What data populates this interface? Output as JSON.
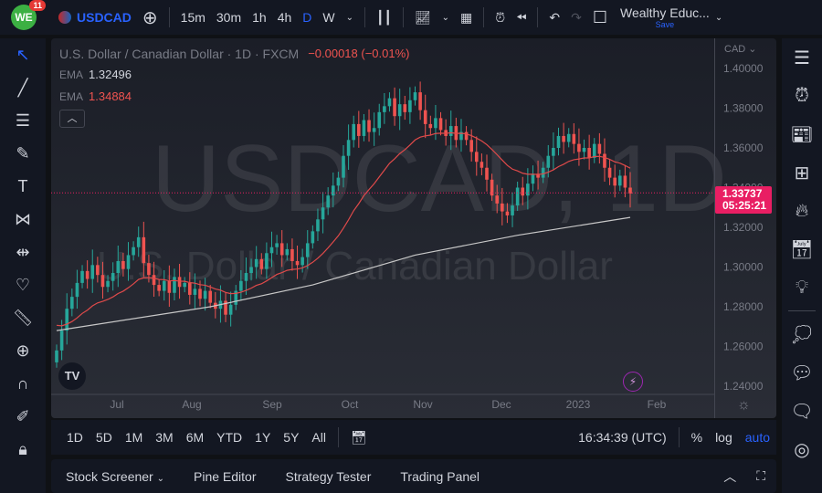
{
  "topbar": {
    "notif_count": "11",
    "symbol": "USDCAD",
    "intervals": [
      "15m",
      "30m",
      "1h",
      "4h",
      "D",
      "W"
    ],
    "layout_name": "Wealthy Educ...",
    "save_label": "Save"
  },
  "legend": {
    "title": "U.S. Dollar / Canadian Dollar · 1D · FXCM",
    "change": "−0.00018 (−0.01%)",
    "ema1_label": "EMA",
    "ema1_value": "1.32496",
    "ema2_label": "EMA",
    "ema2_value": "1.34884"
  },
  "watermark": {
    "symbol": "USDCAD, 1D",
    "name": "U.S. Dollar / Canadian Dollar"
  },
  "price_axis": {
    "currency": "CAD",
    "current_price": "1.33737",
    "countdown": "05:25:21"
  },
  "timeframes": [
    "1D",
    "5D",
    "1M",
    "3M",
    "6M",
    "YTD",
    "1Y",
    "5Y",
    "All"
  ],
  "clock": "16:34:39 (UTC)",
  "axis_options": {
    "percent": "%",
    "log": "log",
    "auto": "auto"
  },
  "bottom_tabs": [
    "Stock Screener",
    "Pine Editor",
    "Strategy Tester",
    "Trading Panel"
  ],
  "colors": {
    "up": "#26a69a",
    "down": "#ef5350",
    "ema_fast": "#e04a4a",
    "ema_slow": "#c8c8c8",
    "accent": "#2962ff",
    "price_label": "#e91e63"
  },
  "chart_data": {
    "type": "candlestick",
    "ylim": [
      1.235,
      1.405
    ],
    "y_ticks": [
      "1.40000",
      "1.38000",
      "1.36000",
      "1.34000",
      "1.32000",
      "1.30000",
      "1.28000",
      "1.26000",
      "1.24000"
    ],
    "x_ticks": [
      "Jul",
      "Aug",
      "Sep",
      "Oct",
      "Nov",
      "Dec",
      "2023",
      "Feb"
    ],
    "closes": [
      1.258,
      1.268,
      1.279,
      1.285,
      1.292,
      1.298,
      1.294,
      1.301,
      1.296,
      1.29,
      1.293,
      1.297,
      1.303,
      1.299,
      1.306,
      1.31,
      1.315,
      1.302,
      1.296,
      1.291,
      1.288,
      1.293,
      1.287,
      1.295,
      1.29,
      1.292,
      1.286,
      1.289,
      1.284,
      1.288,
      1.282,
      1.279,
      1.283,
      1.276,
      1.281,
      1.288,
      1.293,
      1.297,
      1.3,
      1.304,
      1.299,
      1.307,
      1.31,
      1.312,
      1.306,
      1.309,
      1.303,
      1.301,
      1.305,
      1.312,
      1.318,
      1.324,
      1.33,
      1.336,
      1.341,
      1.345,
      1.356,
      1.364,
      1.372,
      1.366,
      1.374,
      1.368,
      1.37,
      1.378,
      1.381,
      1.385,
      1.376,
      1.382,
      1.378,
      1.384,
      1.388,
      1.379,
      1.372,
      1.37,
      1.375,
      1.369,
      1.366,
      1.371,
      1.364,
      1.368,
      1.364,
      1.358,
      1.353,
      1.35,
      1.344,
      1.336,
      1.332,
      1.328,
      1.326,
      1.331,
      1.34,
      1.336,
      1.342,
      1.347,
      1.345,
      1.35,
      1.356,
      1.36,
      1.366,
      1.363,
      1.367,
      1.362,
      1.358,
      1.36,
      1.355,
      1.362,
      1.357,
      1.35,
      1.345,
      1.341,
      1.346,
      1.34,
      1.337
    ],
    "ema_slow_points": [
      [
        0,
        1.268
      ],
      [
        30,
        1.28
      ],
      [
        50,
        1.291
      ],
      [
        70,
        1.306
      ],
      [
        90,
        1.316
      ],
      [
        112,
        1.325
      ]
    ]
  }
}
